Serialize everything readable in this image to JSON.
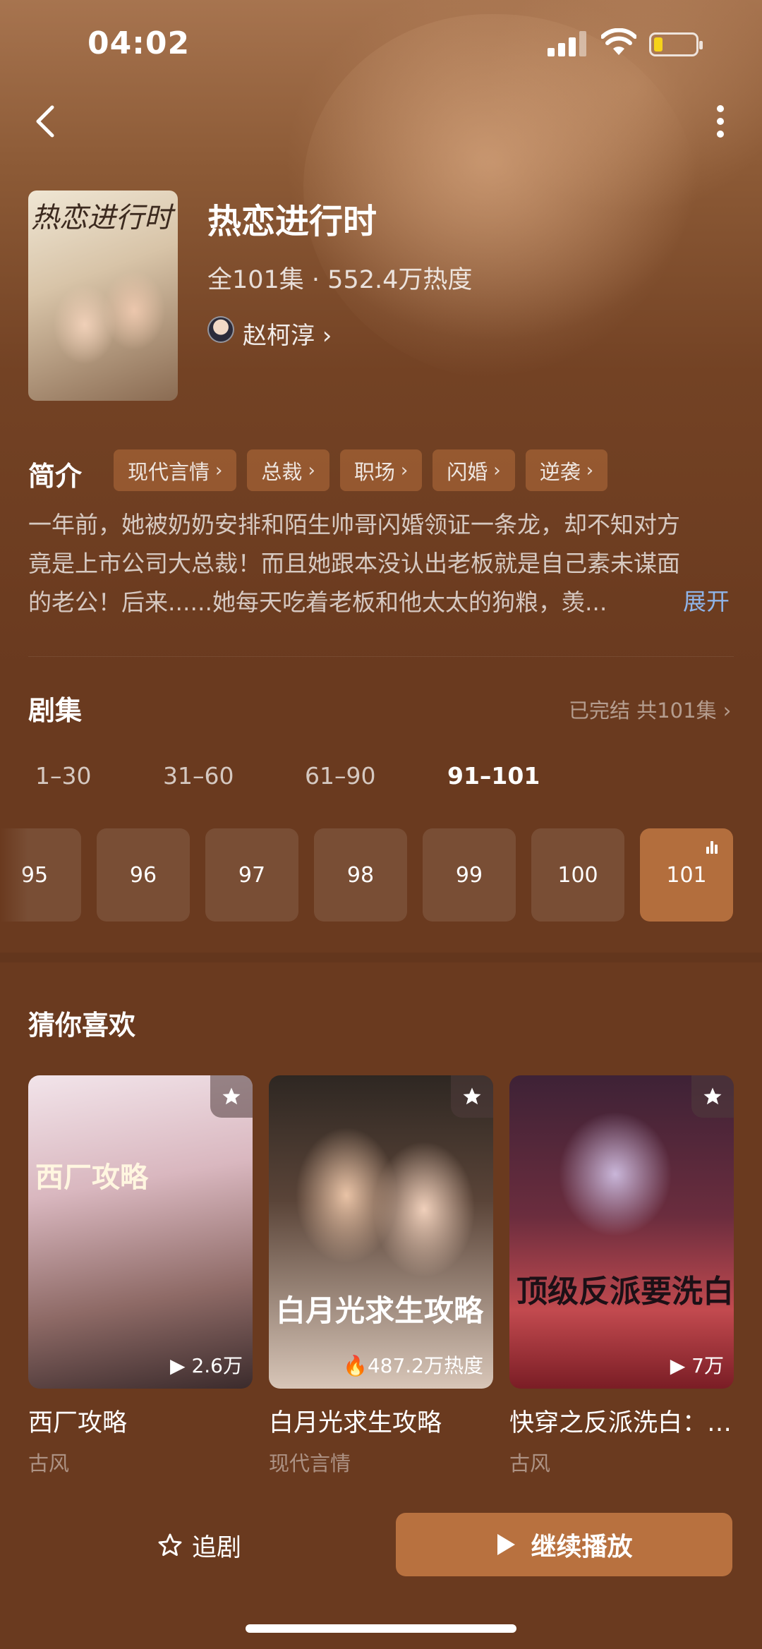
{
  "status_bar": {
    "time": "04:02"
  },
  "show": {
    "poster_title": "热恋进行时",
    "title": "热恋进行时",
    "meta": "全101集 · 552.4万热度",
    "actor": "赵柯淳 ›"
  },
  "intro": {
    "label": "简介",
    "tags": [
      "现代言情",
      "总裁",
      "职场",
      "闪婚",
      "逆袭"
    ],
    "synopsis_lines": [
      "一年前，她被奶奶安排和陌生帅哥闪婚领证一条龙，却不知对方",
      "竟是上市公司大总裁！而且她跟本没认出老板就是自己素未谋面",
      "的老公！后来......她每天吃着老板和他太太的狗粮，羡..."
    ],
    "expand": "展开"
  },
  "episodes": {
    "label": "剧集",
    "status": "已完结 共101集 ›",
    "ranges": [
      "1–30",
      "31–60",
      "61–90",
      "91–101"
    ],
    "active_range": "91–101",
    "items": [
      "95",
      "96",
      "97",
      "98",
      "99",
      "100",
      "101"
    ],
    "current": "101"
  },
  "recommend": {
    "label": "猜你喜欢",
    "items": [
      {
        "title": "西厂攻略",
        "genre": "古风",
        "stat": "▶ 2.6万",
        "cover_text": "西厂攻略"
      },
      {
        "title": "白月光求生攻略",
        "genre": "现代言情",
        "stat": "487.2万热度",
        "cover_text": "白月光求生攻略"
      },
      {
        "title": "快穿之反派洗白：…",
        "genre": "古风",
        "stat": "▶ 7万",
        "cover_text": "顶级反派要洗白"
      }
    ]
  },
  "actions": {
    "follow": "追剧",
    "continue": "继续播放"
  },
  "colors": {
    "background": "#6a3a1f",
    "accent": "#b8713f",
    "link": "#8fb4e8"
  }
}
